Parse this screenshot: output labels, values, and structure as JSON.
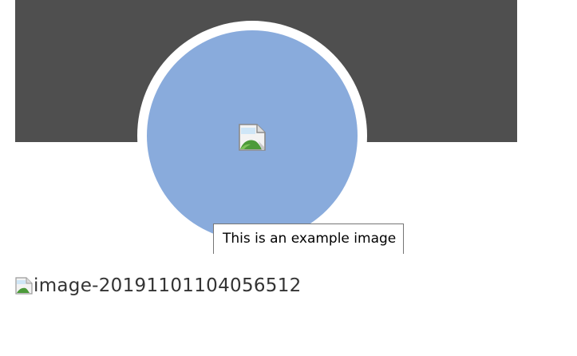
{
  "profile": {
    "avatar_tooltip": "This is an example image",
    "avatar_icon": "broken-image-icon",
    "colors": {
      "cover_band": "#4f4f4f",
      "avatar_ring": "#ffffff",
      "avatar_fill": "#89abdc"
    }
  },
  "content": {
    "image_alt_text": "image-20191101104056512",
    "image_icon": "broken-image-icon"
  }
}
